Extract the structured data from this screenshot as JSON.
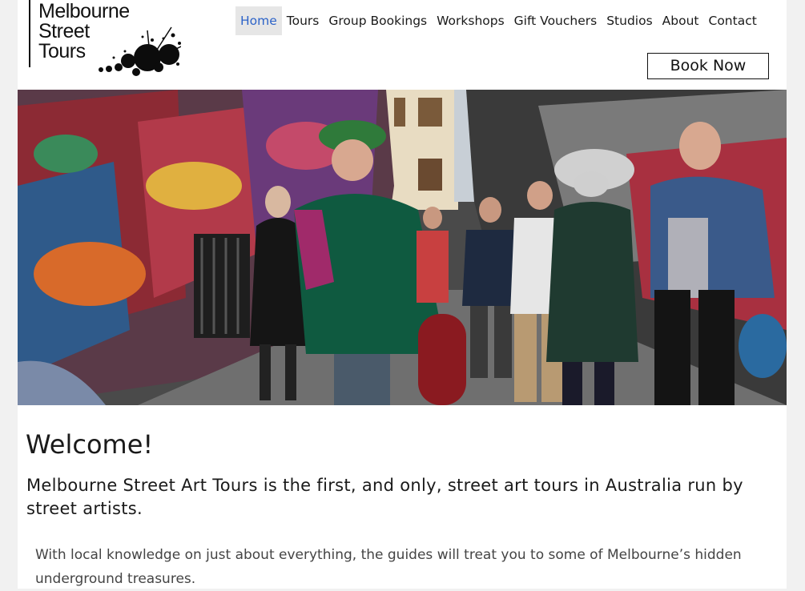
{
  "logo": {
    "lines": [
      "Melbourne",
      "Street",
      "Tours"
    ]
  },
  "nav": {
    "items": [
      {
        "label": "Home",
        "active": true
      },
      {
        "label": "Tours"
      },
      {
        "label": "Group Bookings"
      },
      {
        "label": "Workshops"
      },
      {
        "label": "Gift Vouchers"
      },
      {
        "label": "Studios"
      },
      {
        "label": "About"
      },
      {
        "label": "Contact"
      }
    ],
    "active_color": "#2d63c8"
  },
  "book_button": {
    "label": "Book Now"
  },
  "hero": {
    "icon": "street-art-tour-photo"
  },
  "content": {
    "heading": "Welcome!",
    "tagline": "Melbourne Street Art Tours is the first, and only, street art tours in Australia run by street artists.",
    "intro": "With local knowledge on just about everything, the guides will treat you to some of Melbourne’s hidden underground treasures."
  }
}
